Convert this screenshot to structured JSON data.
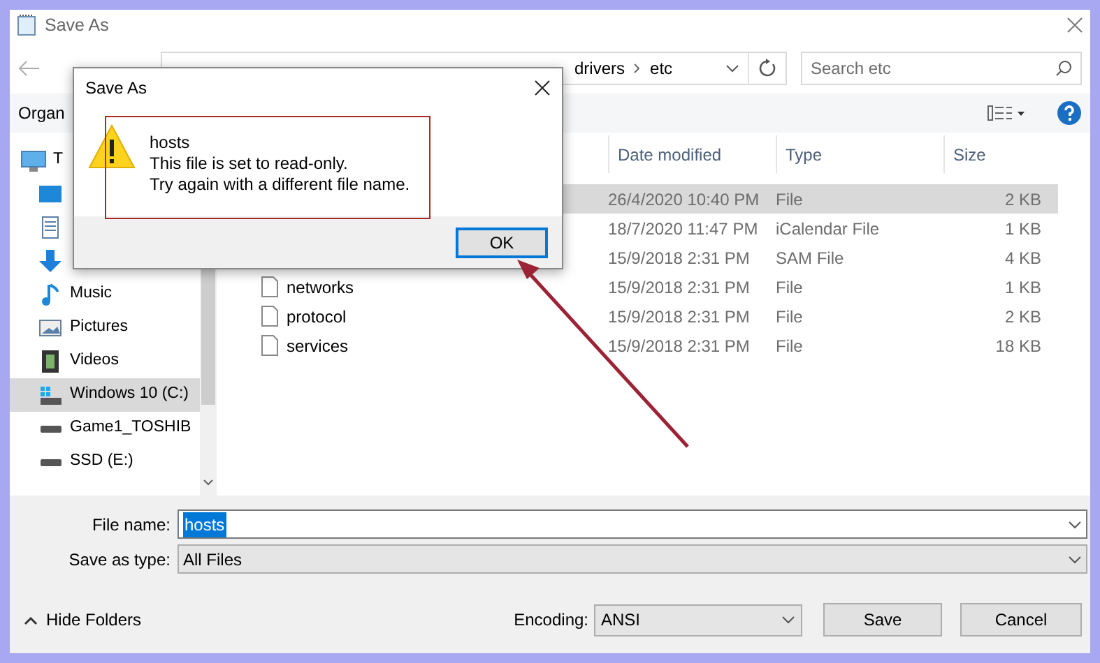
{
  "window": {
    "title": "Save As"
  },
  "address_bar": {
    "crumbs": [
      "drivers",
      "etc"
    ]
  },
  "search": {
    "placeholder": "Search etc"
  },
  "toolbar": {
    "organize": "Organ"
  },
  "sidebar": {
    "items": [
      {
        "kind": "pc",
        "label": "T",
        "selected": false,
        "children": [
          {
            "kind": "desktop",
            "selected": false
          },
          {
            "kind": "documents",
            "selected": false
          },
          {
            "kind": "downloads",
            "selected": false
          },
          {
            "kind": "music",
            "label": "Music",
            "selected": false
          },
          {
            "kind": "pictures",
            "label": "Pictures",
            "selected": false
          },
          {
            "kind": "videos",
            "label": "Videos",
            "selected": false
          },
          {
            "kind": "system-drive",
            "label": "Windows 10 (C:)",
            "selected": true
          },
          {
            "kind": "drive",
            "label": "Game1_TOSHIB",
            "selected": false
          },
          {
            "kind": "drive",
            "label": "SSD (E:)",
            "selected": false
          }
        ]
      }
    ]
  },
  "file_list": {
    "columns": [
      "Date modified",
      "Type",
      "Size"
    ],
    "rows": [
      {
        "date": "26/4/2020 10:40 PM",
        "type": "File",
        "size": "2 KB",
        "selected": true
      },
      {
        "date": "18/7/2020 11:47 PM",
        "type": "iCalendar File",
        "size": "1 KB",
        "selected": false
      },
      {
        "date": "15/9/2018 2:31 PM",
        "type": "SAM File",
        "size": "4 KB",
        "selected": false
      },
      {
        "name": "networks",
        "date": "15/9/2018 2:31 PM",
        "type": "File",
        "size": "1 KB",
        "selected": false
      },
      {
        "name": "protocol",
        "date": "15/9/2018 2:31 PM",
        "type": "File",
        "size": "2 KB",
        "selected": false
      },
      {
        "name": "services",
        "date": "15/9/2018 2:31 PM",
        "type": "File",
        "size": "18 KB",
        "selected": false
      }
    ]
  },
  "file_name": {
    "label": "File name:",
    "value": "hosts"
  },
  "save_as_type": {
    "label": "Save as type:",
    "value": "All Files"
  },
  "hide_folders": "Hide Folders",
  "encoding": {
    "label": "Encoding:",
    "value": "ANSI"
  },
  "buttons": [
    "Save",
    "Cancel"
  ],
  "dialog": {
    "title": "Save As",
    "file": "hosts",
    "message": [
      "This file is set to read-only.",
      "Try again with a different file name."
    ],
    "button": "OK"
  }
}
